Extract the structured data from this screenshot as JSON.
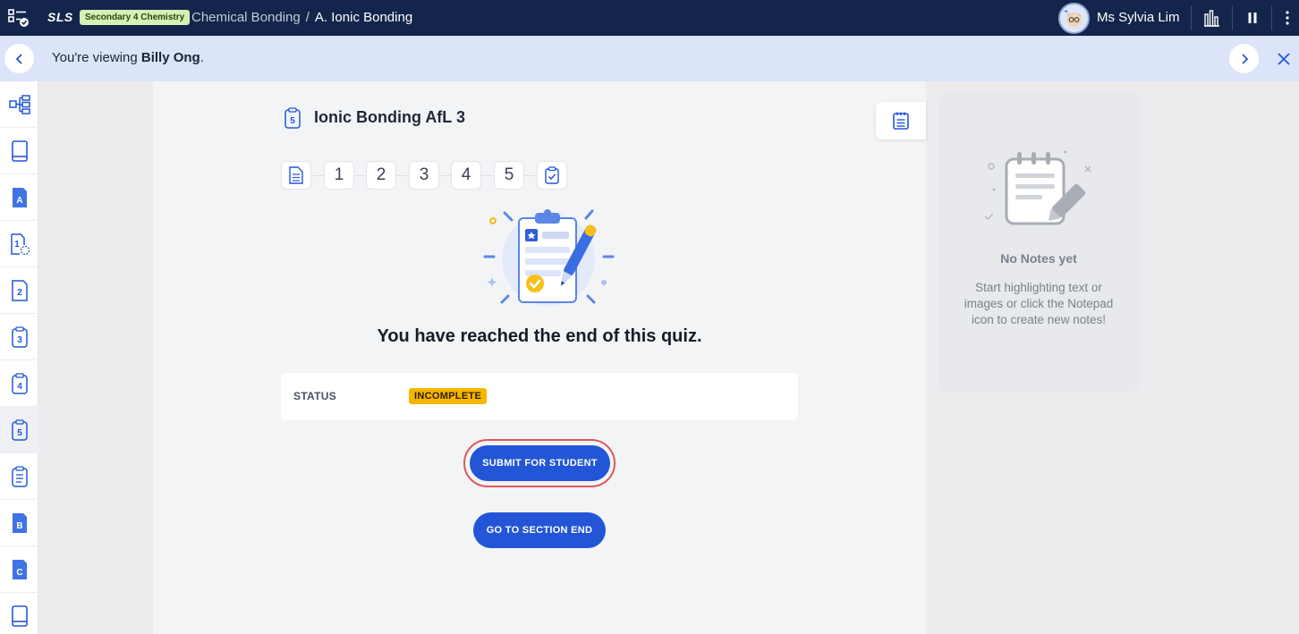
{
  "topbar": {
    "logo": "SLS",
    "subject_badge": "Secondary 4 Chemistry",
    "breadcrumb": [
      "Chemical Bonding",
      "/",
      "A. Ionic Bonding"
    ],
    "teacher_name": "Ms Sylvia Lim"
  },
  "viewbar": {
    "prefix": "You're viewing ",
    "student": "Billy Ong",
    "suffix": "."
  },
  "sidebar": {
    "items": [
      {
        "icon": "sitemap-icon",
        "label": ""
      },
      {
        "icon": "book-icon",
        "label": ""
      },
      {
        "icon": "section-icon",
        "label": "A"
      },
      {
        "icon": "activity-icon",
        "label": "1"
      },
      {
        "icon": "quiz-icon",
        "label": "2"
      },
      {
        "icon": "quiz-icon",
        "label": "3"
      },
      {
        "icon": "quiz-icon",
        "label": "4"
      },
      {
        "icon": "quiz-icon",
        "label": "5"
      },
      {
        "icon": "document-icon",
        "label": ""
      },
      {
        "icon": "section-icon",
        "label": "B"
      },
      {
        "icon": "section-icon",
        "label": "C"
      },
      {
        "icon": "book-icon",
        "label": ""
      }
    ],
    "active_index": 7
  },
  "quiz": {
    "icon_number": "5",
    "title": "Ionic Bonding AfL 3",
    "questions": [
      "1",
      "2",
      "3",
      "4",
      "5"
    ],
    "end_message": "You have reached the end of this quiz.",
    "status_label": "STATUS",
    "status_value": "INCOMPLETE",
    "submit_label": "SUBMIT FOR STUDENT",
    "section_end_label": "GO TO SECTION END"
  },
  "notes": {
    "title": "No Notes yet",
    "description": "Start highlighting text or images or click the Notepad icon to create new notes!"
  },
  "colors": {
    "topbar": "#13254a",
    "viewbar": "#dbe4f8",
    "primary": "#2356d6",
    "status_incomplete": "#f7b500",
    "highlight": "#e0575b"
  }
}
